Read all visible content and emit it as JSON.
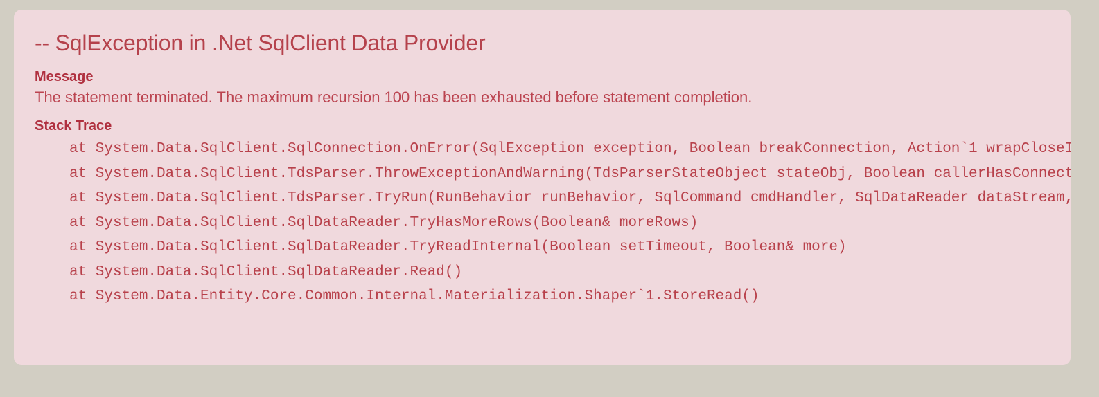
{
  "page": {
    "background_color": "#d2cec3"
  },
  "error_panel": {
    "background_color": "#f0d9dd",
    "text_color": "#b8414b",
    "heading_color": "#b0303f",
    "title": "-- SqlException in .Net SqlClient Data Provider",
    "message_heading": "Message",
    "message_text": "The statement terminated. The maximum recursion 100 has been exhausted before statement completion.",
    "stack_trace_heading": "Stack Trace",
    "stack_trace_lines": [
      "at System.Data.SqlClient.SqlConnection.OnError(SqlException exception, Boolean breakConnection, Action`1 wrapCloseInAction)",
      "at System.Data.SqlClient.TdsParser.ThrowExceptionAndWarning(TdsParserStateObject stateObj, Boolean callerHasConnectionLock, Boolean asyncClose)",
      "at System.Data.SqlClient.TdsParser.TryRun(RunBehavior runBehavior, SqlCommand cmdHandler, SqlDataReader dataStream, BulkCopySimpleResultSet bulkCopyHandler, TdsParserStateObject stateObj, Boolean& dataReady)",
      "at System.Data.SqlClient.SqlDataReader.TryHasMoreRows(Boolean& moreRows)",
      "at System.Data.SqlClient.SqlDataReader.TryReadInternal(Boolean setTimeout, Boolean& more)",
      "at System.Data.SqlClient.SqlDataReader.Read()",
      "at System.Data.Entity.Core.Common.Internal.Materialization.Shaper`1.StoreRead()"
    ]
  }
}
